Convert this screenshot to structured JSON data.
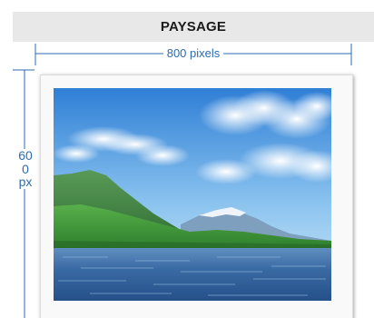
{
  "header": {
    "title": "PAYSAGE"
  },
  "width_dimension": {
    "label": "800 pixels"
  },
  "height_dimension": {
    "label": "600 px"
  },
  "photo": {
    "subject": "landscape-icon"
  },
  "colors": {
    "header_bg": "#e8e8e8",
    "dimension_line": "#2b6cb0",
    "sky_top": "#2f7fd6",
    "sky_bottom": "#cfe8f8",
    "water": "#2f5f9a",
    "hills": "#3f8f3a"
  }
}
